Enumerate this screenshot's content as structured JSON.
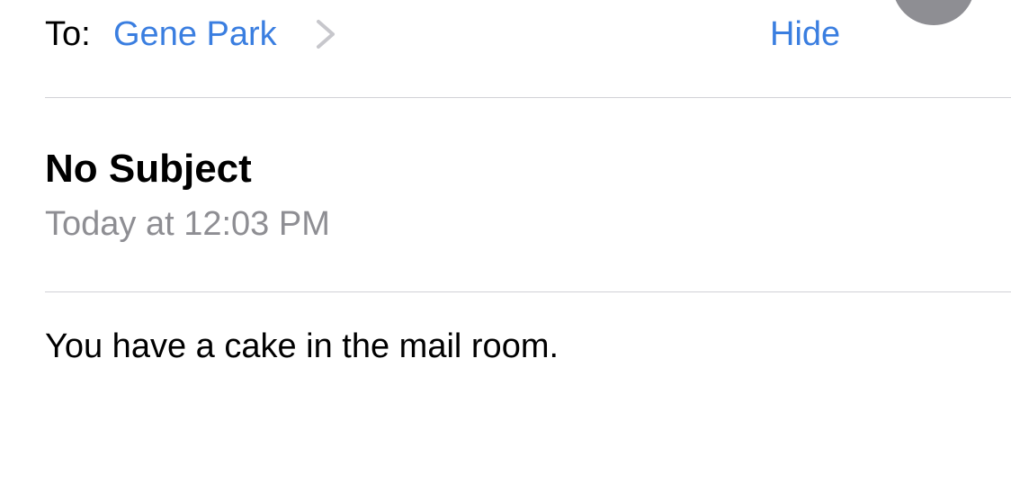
{
  "header": {
    "to_label": "To:",
    "recipient_name": "Gene Park",
    "hide_label": "Hide",
    "chevron_icon": "chevron-right-icon"
  },
  "message": {
    "subject": "No Subject",
    "timestamp": "Today at 12:03 PM",
    "body": "You have a cake in the mail room."
  },
  "colors": {
    "link": "#3a7ee0",
    "secondary_text": "#8e8e93",
    "divider": "#d1d1d6",
    "avatar": "#8e8e93"
  }
}
